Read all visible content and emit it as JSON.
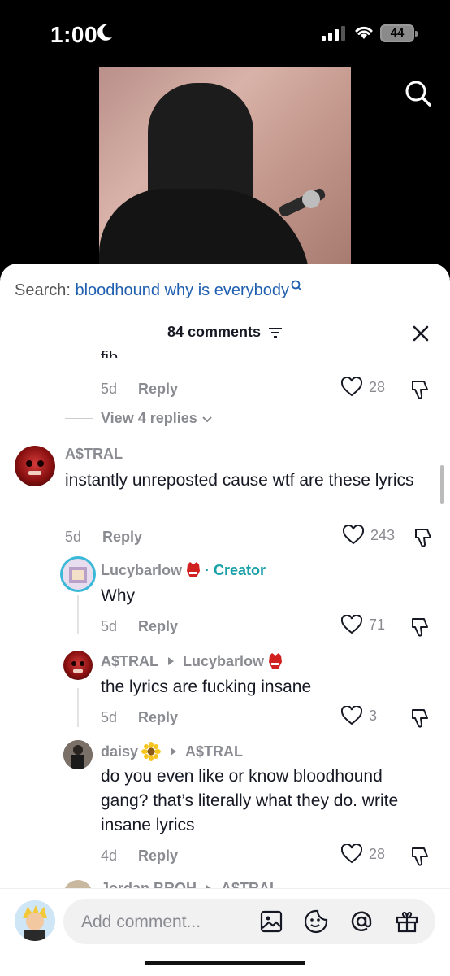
{
  "status": {
    "time": "1:00",
    "battery": "44"
  },
  "search": {
    "prefix": "Search: ",
    "query": "bloodhound why is everybody"
  },
  "comments_header": {
    "count": "84 comments"
  },
  "previous": {
    "cut_text": "fib",
    "date": "5d",
    "reply": "Reply",
    "likes": "28",
    "view_replies": "View 4 replies"
  },
  "comments": [
    {
      "user": "A$TRAL",
      "text": "instantly unreposted cause wtf are these lyrics",
      "date": "5d",
      "reply": "Reply",
      "likes": "243"
    },
    {
      "user": "Lucybarlow",
      "badge": "· Creator",
      "text": "Why",
      "date": "5d",
      "reply": "Reply",
      "likes": "71"
    },
    {
      "user": "A$TRAL",
      "reply_to": "Lucybarlow",
      "text": "the lyrics are fucking insane",
      "date": "5d",
      "reply": "Reply",
      "likes": "3"
    },
    {
      "user": "daisy",
      "reply_to": "A$TRAL",
      "text": "do you even like or know bloodhound gang? that’s literally what they do. write insane lyrics",
      "date": "4d",
      "reply": "Reply",
      "likes": "28"
    },
    {
      "user": "Jordan BROH",
      "reply_to": "A$TRAL"
    }
  ],
  "composer": {
    "placeholder": "Add comment..."
  },
  "colors": {
    "creator": "#1aa0a8",
    "search_query": "#1f5fb0",
    "secondary_text": "#8a8b91"
  }
}
